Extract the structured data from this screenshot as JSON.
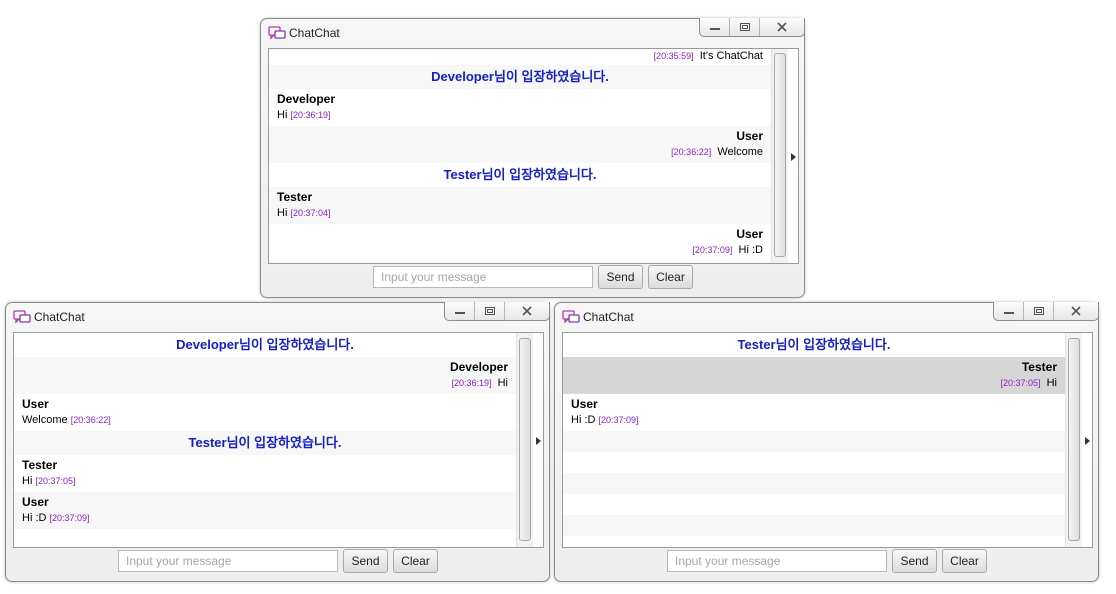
{
  "app": {
    "title": "ChatChat"
  },
  "colors": {
    "notice": "#1520c4",
    "timestamp": "#8b1fc8",
    "selected_row": "#d6d6d6"
  },
  "icons": {
    "app": "chat-bubbles-icon",
    "minimize": "minimize-icon",
    "maximize": "maximize-icon",
    "close": "close-icon",
    "expand": "triangle-right-icon"
  },
  "windows": [
    {
      "title": "ChatChat",
      "input_placeholder": "Input your message",
      "send_label": "Send",
      "clear_label": "Clear",
      "rows": [
        {
          "kind": "sys",
          "timestamp": "[20:35:59]",
          "text": "It's ChatChat"
        },
        {
          "kind": "notice",
          "text": "Developer님이 입장하였습니다."
        },
        {
          "kind": "msg",
          "align": "left",
          "sender": "Developer",
          "text": "Hi",
          "timestamp": "[20:36:19]"
        },
        {
          "kind": "msg",
          "align": "right",
          "sender": "User",
          "text": "Welcome",
          "timestamp": "[20:36:22]"
        },
        {
          "kind": "notice",
          "text": "Tester님이 입장하였습니다."
        },
        {
          "kind": "msg",
          "align": "left",
          "sender": "Tester",
          "text": "Hi",
          "timestamp": "[20:37:04]"
        },
        {
          "kind": "msg",
          "align": "right",
          "sender": "User",
          "text": "Hi :D",
          "timestamp": "[20:37:09]"
        }
      ]
    },
    {
      "title": "ChatChat",
      "input_placeholder": "Input your message",
      "send_label": "Send",
      "clear_label": "Clear",
      "rows": [
        {
          "kind": "notice",
          "text": "Developer님이 입장하였습니다."
        },
        {
          "kind": "msg",
          "align": "right",
          "sender": "Developer",
          "text": "Hi",
          "timestamp": "[20:36:19]"
        },
        {
          "kind": "msg",
          "align": "left",
          "sender": "User",
          "text": "Welcome",
          "timestamp": "[20:36:22]"
        },
        {
          "kind": "notice",
          "text": "Tester님이 입장하였습니다."
        },
        {
          "kind": "msg",
          "align": "left",
          "sender": "Tester",
          "text": "Hi",
          "timestamp": "[20:37:05]"
        },
        {
          "kind": "msg",
          "align": "left",
          "sender": "User",
          "text": "Hi :D",
          "timestamp": "[20:37:09]"
        }
      ]
    },
    {
      "title": "ChatChat",
      "input_placeholder": "Input your message",
      "send_label": "Send",
      "clear_label": "Clear",
      "rows": [
        {
          "kind": "notice",
          "text": "Tester님이 입장하였습니다."
        },
        {
          "kind": "msg",
          "align": "right",
          "sender": "Tester",
          "text": "Hi",
          "timestamp": "[20:37:05]",
          "selected": true
        },
        {
          "kind": "msg",
          "align": "left",
          "sender": "User",
          "text": "Hi :D",
          "timestamp": "[20:37:09]"
        },
        {
          "kind": "filler"
        },
        {
          "kind": "filler"
        },
        {
          "kind": "filler"
        },
        {
          "kind": "filler"
        },
        {
          "kind": "filler"
        }
      ]
    }
  ]
}
